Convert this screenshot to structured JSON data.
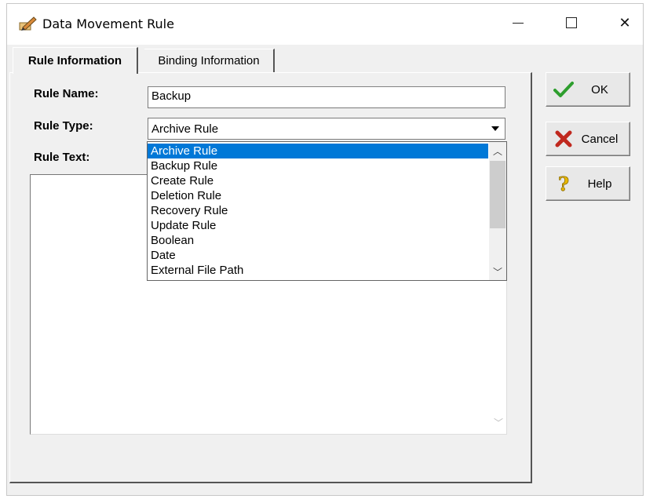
{
  "window": {
    "title": "Data Movement Rule",
    "controls": {
      "minimize": "—",
      "maximize": "☐",
      "close": "✕"
    }
  },
  "tabs": [
    {
      "label": "Rule Information",
      "active": true
    },
    {
      "label": "Binding Information",
      "active": false
    }
  ],
  "form": {
    "rule_name_label": "Rule Name:",
    "rule_name_value": "Backup",
    "rule_type_label": "Rule Type:",
    "rule_type_value": "Archive Rule",
    "rule_text_label": "Rule Text:",
    "rule_text_value": ""
  },
  "rule_type_options": [
    "Archive Rule",
    "Backup Rule",
    "Create Rule",
    "Deletion Rule",
    "Recovery Rule",
    "Update Rule",
    "Boolean",
    "Date",
    "External File Path"
  ],
  "selected_option_index": 0,
  "buttons": {
    "ok": "OK",
    "cancel": "Cancel",
    "help": "Help"
  },
  "icons": {
    "window": "pencil-rule-icon",
    "ok": "checkmark-icon",
    "cancel": "red-x-icon",
    "help": "question-mark-icon"
  },
  "colors": {
    "selection": "#0078d7",
    "ok_check": "#2e9e2e",
    "cancel_x": "#c0281e",
    "help_mark": "#e8b800"
  }
}
